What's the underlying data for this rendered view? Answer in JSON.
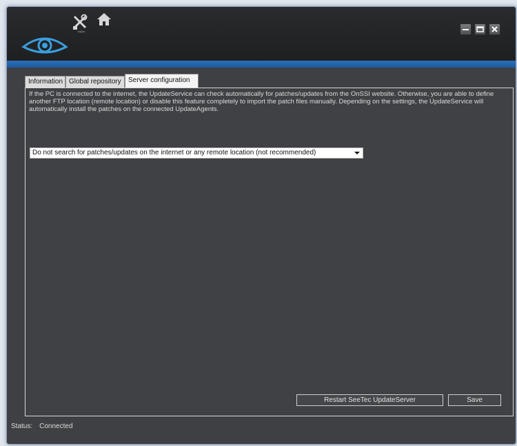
{
  "window": {
    "controls": {
      "minimize_icon": "minimize-icon",
      "maximize_icon": "maximize-icon",
      "close_icon": "close-icon"
    }
  },
  "header": {
    "logo_icon": "eye-logo-icon",
    "tools_icon": "tools-icon",
    "home_icon": "home-icon"
  },
  "tabs": [
    {
      "label": "Information",
      "active": false
    },
    {
      "label": "Global repository",
      "active": false
    },
    {
      "label": "Server configuration",
      "active": true
    }
  ],
  "server_config": {
    "description": "If the PC is connected to the internet, the UpdateService can check automatically for patches/updates from the OnSSI website. Otherwise, you are able to define another FTP location (remote location) or disable this feature completely to import the patch files manually. Depending on the settings, the UpdateService will automatically install the patches on the connected UpdateAgents.",
    "search_option_selected": "Do not search for patches/updates on the internet or any remote location (not recommended)",
    "restart_button": "Restart SeeTec UpdateServer",
    "save_button": "Save"
  },
  "status": {
    "label": "Status:",
    "value": "Connected"
  },
  "colors": {
    "window_bg": "#3f4043",
    "title_bg": "#1e1f21",
    "accent_blue": "#2c6fb8",
    "logo_blue": "#3aa0e0"
  }
}
